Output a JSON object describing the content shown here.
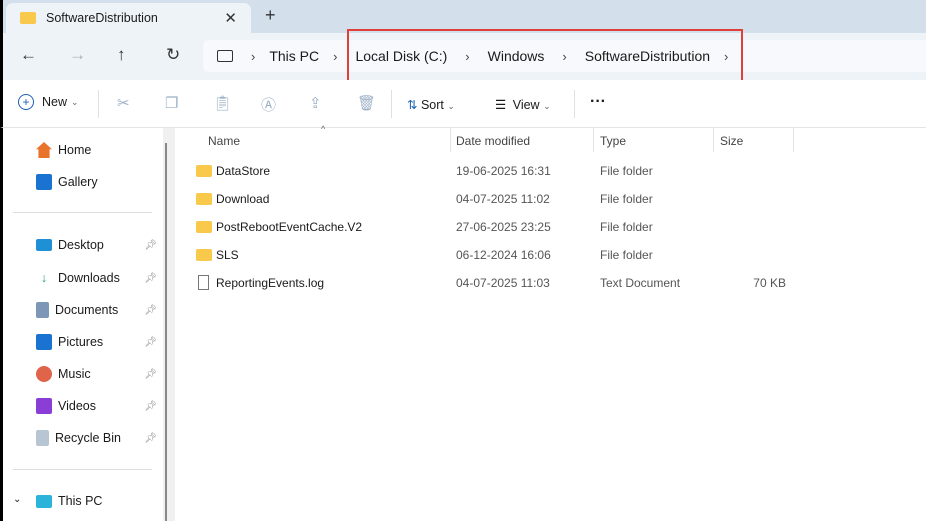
{
  "tab": {
    "title": "SoftwareDistribution",
    "close": "✕",
    "new_tab": "+"
  },
  "nav": {
    "back": "←",
    "forward": "→",
    "up": "↑",
    "refresh": "↻"
  },
  "breadcrumb": [
    "This PC",
    "Local Disk (C:)",
    "Windows",
    "SoftwareDistribution"
  ],
  "toolbar": {
    "new": "New",
    "sort": "Sort",
    "view": "View",
    "more": "···"
  },
  "sidebar": {
    "items": [
      {
        "label": "Home",
        "color": "#e8742c"
      },
      {
        "label": "Gallery",
        "color": "#1a73d0"
      }
    ],
    "pinned": [
      {
        "label": "Desktop",
        "color": "#1f8fd6"
      },
      {
        "label": "Downloads",
        "color": "#22a36b"
      },
      {
        "label": "Documents",
        "color": "#7f97b6"
      },
      {
        "label": "Pictures",
        "color": "#1a73d0"
      },
      {
        "label": "Music",
        "color": "#e0644a"
      },
      {
        "label": "Videos",
        "color": "#8a3ed6"
      },
      {
        "label": "Recycle Bin",
        "color": "#b8c6d4"
      }
    ],
    "this_pc": "This PC"
  },
  "columns": {
    "name": "Name",
    "date": "Date modified",
    "type": "Type",
    "size": "Size"
  },
  "files": [
    {
      "name": "DataStore",
      "date": "19-06-2025 16:31",
      "type": "File folder",
      "size": "",
      "kind": "folder"
    },
    {
      "name": "Download",
      "date": "04-07-2025 11:02",
      "type": "File folder",
      "size": "",
      "kind": "folder"
    },
    {
      "name": "PostRebootEventCache.V2",
      "date": "27-06-2025 23:25",
      "type": "File folder",
      "size": "",
      "kind": "folder"
    },
    {
      "name": "SLS",
      "date": "06-12-2024 16:06",
      "type": "File folder",
      "size": "",
      "kind": "folder"
    },
    {
      "name": "ReportingEvents.log",
      "date": "04-07-2025 11:03",
      "type": "Text Document",
      "size": "70 KB",
      "kind": "file"
    }
  ]
}
